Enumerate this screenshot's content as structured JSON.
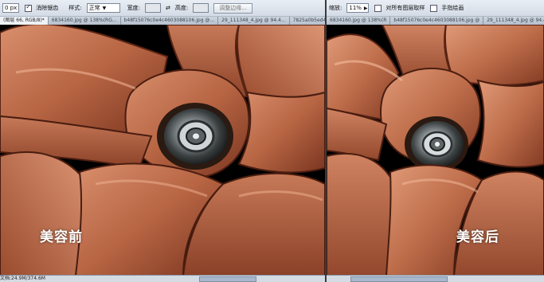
{
  "left_pane": {
    "options_bar": {
      "feather_value": "0 px",
      "antialias_label": "消除锯齿",
      "style_label": "样式:",
      "style_value": "正常",
      "width_label": "宽度:",
      "height_label": "高度:",
      "refine_edge_button": "调整边缘..."
    },
    "tabs": [
      {
        "label": "(图层 66, RGB/8)*",
        "active": true
      },
      {
        "label": "6834160.jpg @ 138%(RG...",
        "active": false
      },
      {
        "label": "b48f15076c0e4c4603088106.jpg @...",
        "active": false
      },
      {
        "label": "29_111348_4.jpg @ 94.4...",
        "active": false
      },
      {
        "label": "7825a0b5ed4ab...",
        "active": false
      }
    ],
    "caption": "美容前",
    "status_text": "文档:24.9M/374.6M"
  },
  "right_pane": {
    "options_bar": {
      "zoom_label": "缩放:",
      "zoom_value": "11%",
      "all_layers_label": "对所有图层取样",
      "pressure_label": "手指绘画"
    },
    "tabs": [
      {
        "label": "6834160.jpg @ 138%(R",
        "active": false
      },
      {
        "label": "b48f15076c0e4c4603088106.jpg @",
        "active": false
      },
      {
        "label": "29_111348_4.jpg @ 94.4",
        "active": false
      }
    ],
    "caption": "美容后"
  },
  "colors": {
    "skin_light": "#d68a6a",
    "skin_mid": "#b4603f",
    "skin_dark": "#6e2d18",
    "chrome_bar": "#dbe2ea"
  }
}
